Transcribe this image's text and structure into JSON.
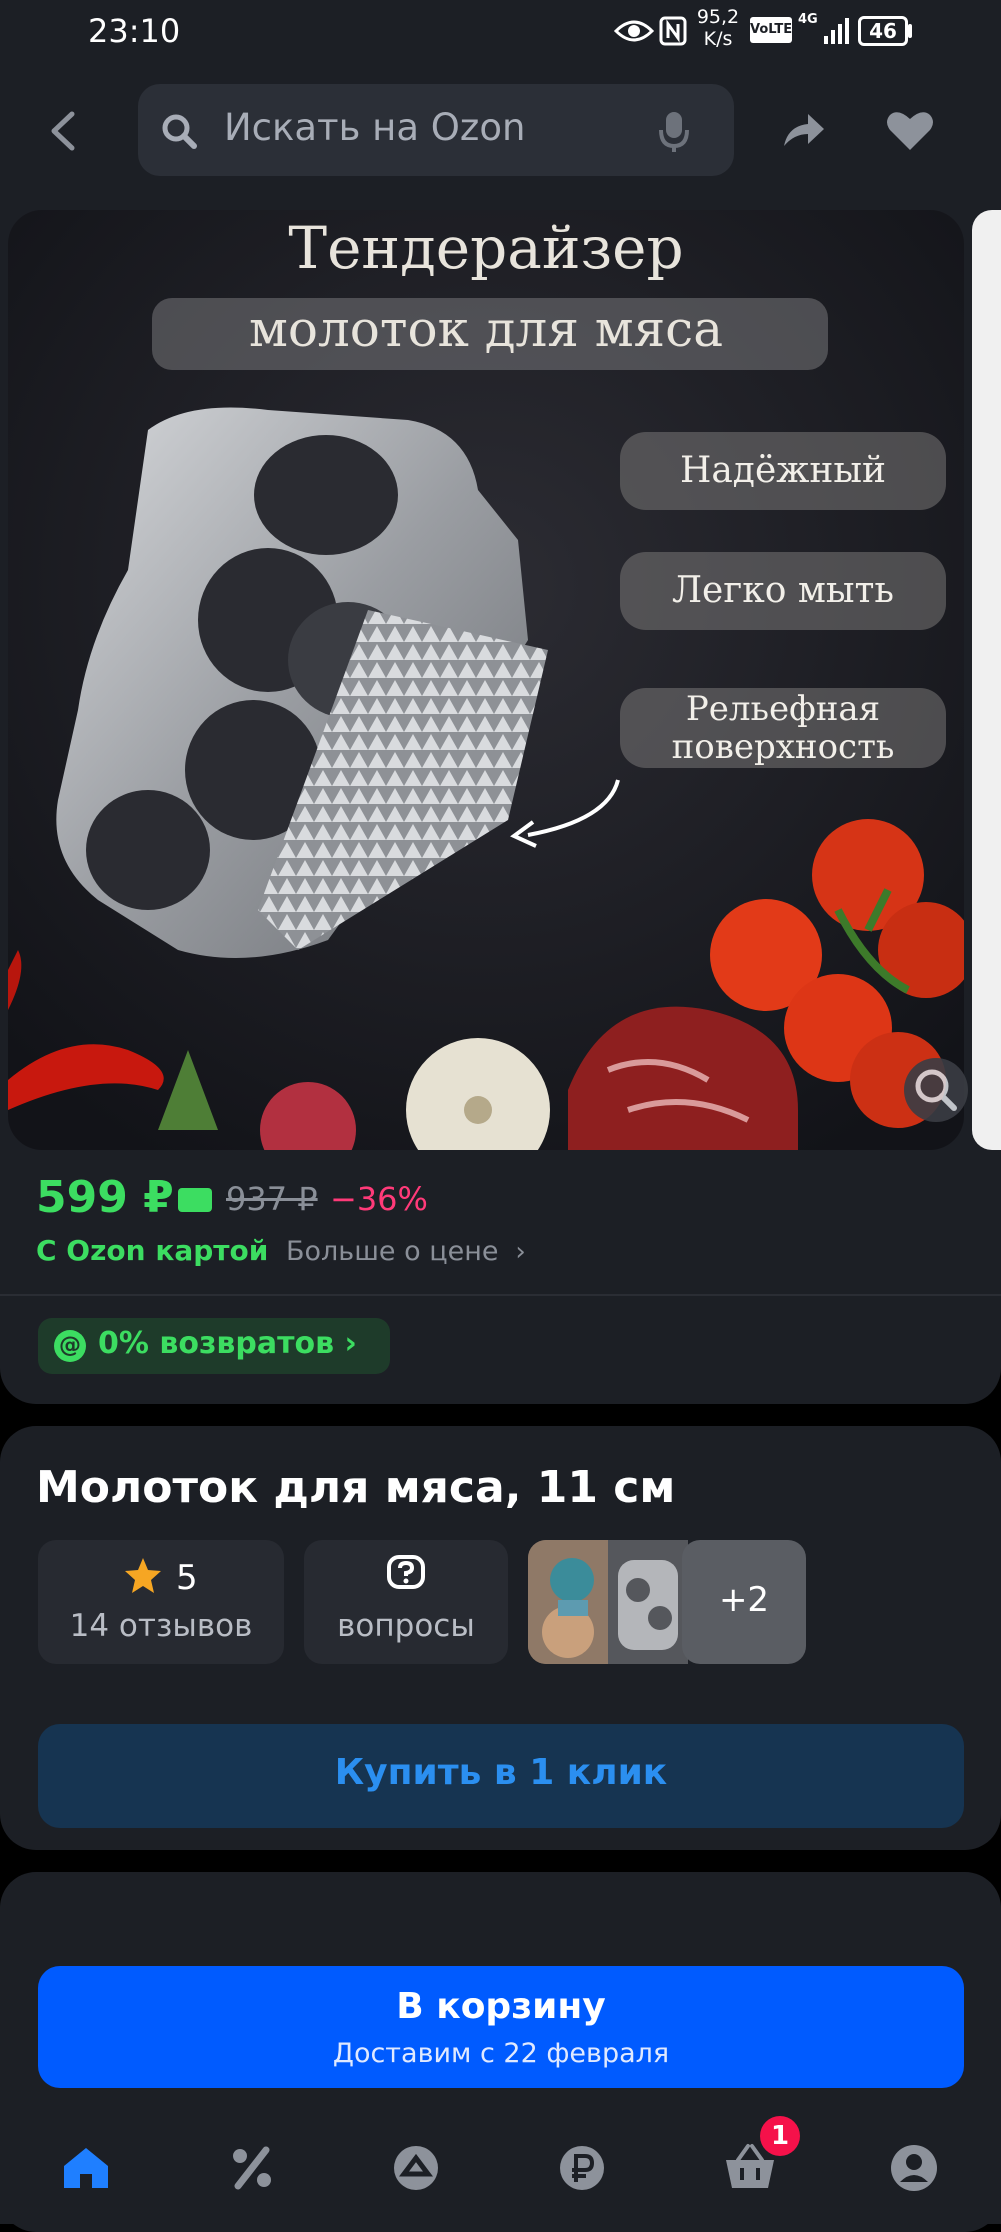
{
  "status_bar": {
    "time": "23:10",
    "net_speed_value": "95,2",
    "net_speed_unit": "K/s",
    "volte": "VoLTE",
    "network": "4G",
    "battery": "46"
  },
  "header": {
    "search_placeholder": "Искать на Ozon"
  },
  "gallery": {
    "image_title": "Тендерайзер",
    "image_subtitle": "молоток для мяса",
    "features": [
      "Надёжный",
      "Легко мыть",
      "Рельефная",
      "поверхность"
    ]
  },
  "price": {
    "current": "599 ₽",
    "old": "937 ₽",
    "discount": "−36%",
    "ozon_card_label": "С Ozon картой",
    "more_label": "Больше о цене"
  },
  "returns": {
    "label": "0% возвратов"
  },
  "product": {
    "title": "Молоток для мяса, 11 см",
    "rating": "5",
    "reviews": "14 отзывов",
    "questions": "вопросы",
    "more_photos": "+2",
    "buy_one_click": "Купить в 1 клик"
  },
  "cart": {
    "label": "В корзину",
    "delivery": "Доставим с 22 февраля"
  },
  "nav": {
    "cart_badge": "1"
  },
  "colors": {
    "accent_green": "#3cdd61",
    "discount_pink": "#ff3a79",
    "primary_blue": "#005bff",
    "badge_red": "#f5114a"
  }
}
